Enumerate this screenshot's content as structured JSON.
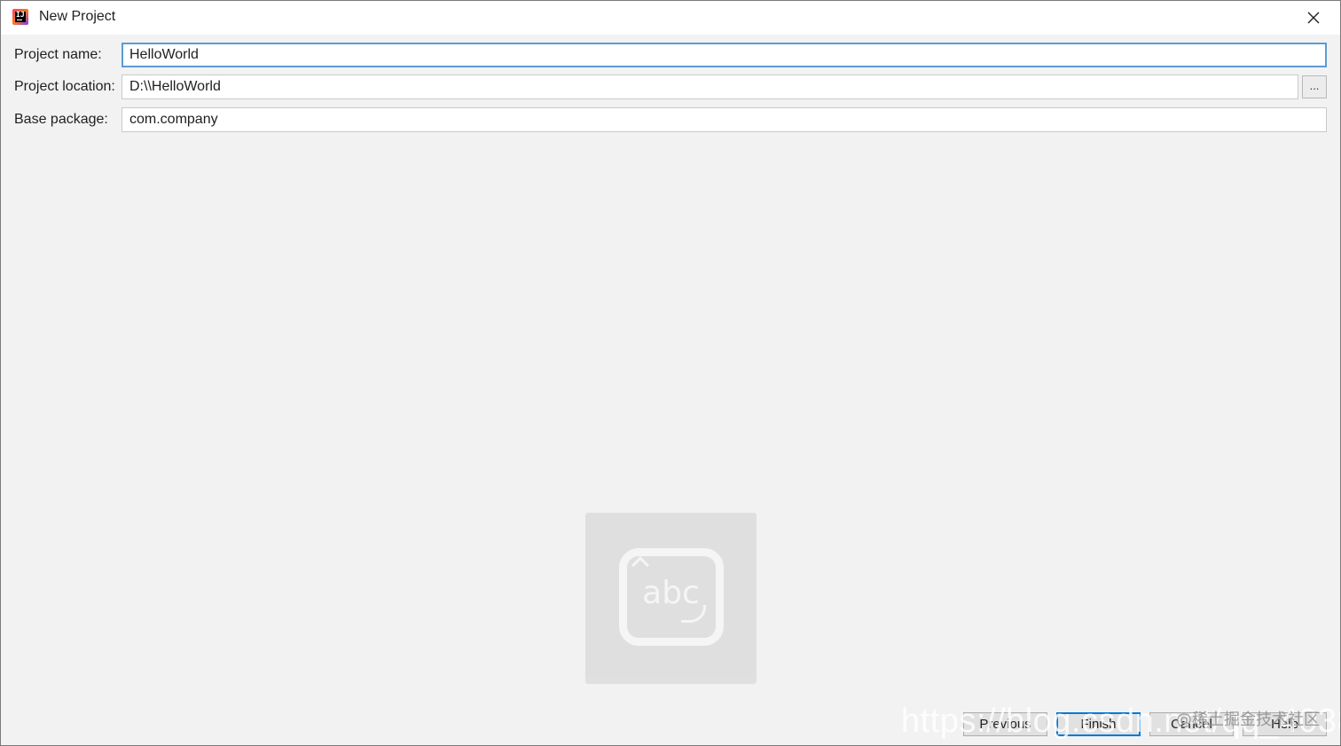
{
  "window": {
    "title": "New Project",
    "app_icon": "intellij-idea-icon",
    "close_icon": "close-icon"
  },
  "form": {
    "project_name": {
      "label": "Project name:",
      "value": "HelloWorld"
    },
    "project_location": {
      "label": "Project location:",
      "value": "D:\\\\HelloWorld",
      "browse_label": "..."
    },
    "base_package": {
      "label": "Base package:",
      "value": "com.company"
    }
  },
  "ime_indicator": {
    "text": "abc"
  },
  "footer": {
    "previous_label": "Previous",
    "finish_label": "Finish",
    "cancel_label": "Cancel",
    "help_label": "Help"
  },
  "watermark": {
    "url_text": "https://blog.csdn.net/qq_4038",
    "community_text": "@稀土掘金技术社区"
  },
  "colors": {
    "focus_border": "#5b9bd5",
    "primary_button_border": "#0078d7",
    "dialog_background": "#f2f2f2"
  }
}
